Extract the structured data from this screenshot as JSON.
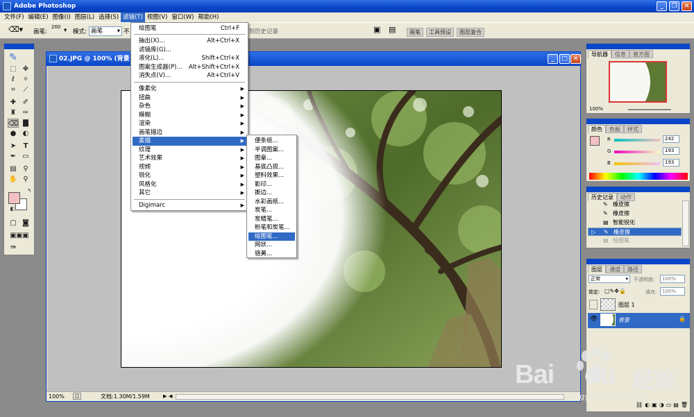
{
  "app": {
    "title": "Adobe Photoshop"
  },
  "menubar": [
    "文件(F)",
    "编辑(E)",
    "图像(I)",
    "图层(L)",
    "选择(S)",
    "滤镜(T)",
    "视图(V)",
    "窗口(W)",
    "帮助(H)"
  ],
  "options": {
    "brush_label": "画笔:",
    "brush_size": "200",
    "mode_label": "模式:",
    "mode_value": "画笔",
    "erase_history": "抹到历史记录",
    "wells": [
      "画笔",
      "工具预设",
      "图层复合"
    ]
  },
  "document": {
    "title": "02.JPG @ 100% (背景",
    "zoom": "100%",
    "doc_size": "文档:1.30M/1.59M"
  },
  "filter_menu": {
    "items": [
      {
        "label": "绘图笔",
        "shortcut": "Ctrl+F"
      },
      {
        "label": "抽出(X)...",
        "shortcut": "Alt+Ctrl+X"
      },
      {
        "label": "滤镜库(G)...",
        "shortcut": ""
      },
      {
        "label": "液化(L)...",
        "shortcut": "Shift+Ctrl+X"
      },
      {
        "label": "图案生成器(P)...",
        "shortcut": "Alt+Shift+Ctrl+X"
      },
      {
        "label": "消失点(V)...",
        "shortcut": "Alt+Ctrl+V"
      },
      {
        "label": "像素化",
        "shortcut": ""
      },
      {
        "label": "扭曲",
        "shortcut": ""
      },
      {
        "label": "杂色",
        "shortcut": ""
      },
      {
        "label": "模糊",
        "shortcut": ""
      },
      {
        "label": "渲染",
        "shortcut": ""
      },
      {
        "label": "画笔描边",
        "shortcut": ""
      },
      {
        "label": "素描",
        "shortcut": ""
      },
      {
        "label": "纹理",
        "shortcut": ""
      },
      {
        "label": "艺术效果",
        "shortcut": ""
      },
      {
        "label": "视频",
        "shortcut": ""
      },
      {
        "label": "锐化",
        "shortcut": ""
      },
      {
        "label": "风格化",
        "shortcut": ""
      },
      {
        "label": "其它",
        "shortcut": ""
      },
      {
        "label": "Digimarc",
        "shortcut": ""
      }
    ]
  },
  "sketch_submenu": [
    "便条纸...",
    "半调图案...",
    "图章...",
    "基底凸现...",
    "塑料效果...",
    "影印...",
    "撕边...",
    "水彩画纸...",
    "炭笔...",
    "炭精笔...",
    "粉笔和炭笔...",
    "绘图笔...",
    "网状...",
    "铬黄..."
  ],
  "navigator": {
    "tabs": [
      "导航器",
      "信息",
      "直方图"
    ],
    "zoom": "100%"
  },
  "color": {
    "tabs": [
      "颜色",
      "色板",
      "样式"
    ],
    "r": "242",
    "g": "193",
    "b": "193",
    "r_label": "R",
    "g_label": "G",
    "b_label": "B"
  },
  "history": {
    "tabs": [
      "历史记录",
      "动作"
    ],
    "items": [
      "橡皮擦",
      "橡皮擦",
      "智能锐化",
      "橡皮擦",
      "绘图笔"
    ]
  },
  "layers": {
    "tabs": [
      "图层",
      "通道",
      "路径"
    ],
    "blend": "正常",
    "opacity_label": "不透明度:",
    "opacity": "100%",
    "lock_label": "锁定:",
    "fill_label": "填充:",
    "fill": "100%",
    "items": [
      "图层 1",
      "背景"
    ]
  },
  "watermark": {
    "brand": "Bai",
    "brand2": "du",
    "suffix": "经验",
    "url": "jingyan.baidu.com"
  },
  "colors": {
    "accent": "#316ac5",
    "title_blue": "#0a46c8",
    "foreground": "#f2c1c1"
  }
}
